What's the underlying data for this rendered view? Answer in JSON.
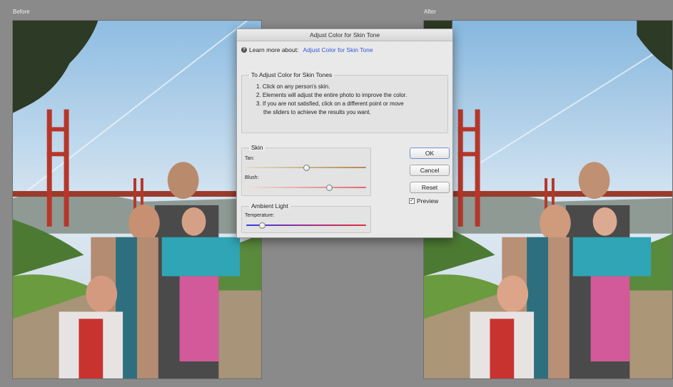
{
  "labels": {
    "before": "Before",
    "after": "After"
  },
  "dialog": {
    "title": "Adjust Color for Skin Tone",
    "learn_prefix": "Learn more about:",
    "learn_link": "Adjust Color for Skin Tone",
    "instructions": {
      "title": "To Adjust Color for Skin Tones",
      "steps": [
        "1. Click on any person's skin.",
        "2. Elements will adjust the entire photo to improve the color.",
        "3. If you are not satisfied, click on a different point or move",
        "the sliders to achieve the results you want."
      ]
    },
    "skin": {
      "title": "Skin",
      "tan_label": "Tan:",
      "tan_value": 0.5,
      "blush_label": "Blush:",
      "blush_value": 0.69
    },
    "ambient": {
      "title": "Ambient Light",
      "temperature_label": "Temperature:",
      "temperature_value": 0.13
    },
    "buttons": {
      "ok": "OK",
      "cancel": "Cancel",
      "reset": "Reset"
    },
    "preview_label": "Preview",
    "preview_checked": true
  },
  "colors": {
    "tan_track": "#c9a97a",
    "blush_track": "#e3a0a0",
    "temp_start": "#3040e0",
    "temp_end": "#e03040",
    "link": "#2f57d8"
  }
}
